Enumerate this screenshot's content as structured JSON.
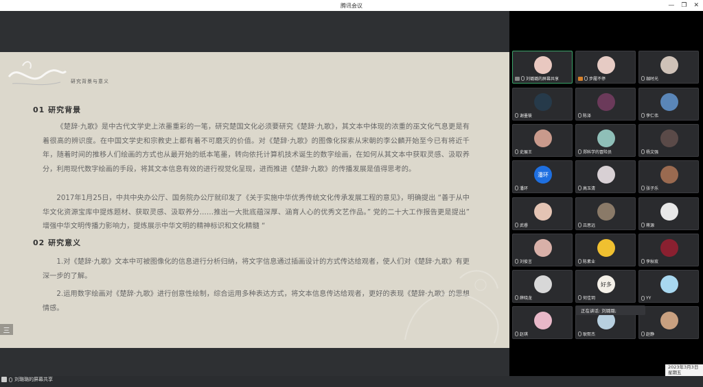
{
  "window": {
    "title": "腾讯会议",
    "minimize": "—",
    "restore": "❐",
    "close": "✕"
  },
  "slide": {
    "header": "研究背景与意义",
    "section1_title": "01  研究背景",
    "para1": "《楚辞·九歌》是中古代文学史上浓墨重彩的一笔，研究楚国文化必须要研究《楚辞·九歌》，其文本中体现的浓重的巫文化气息更是有着很高的辨识度。在中国文学史和宗教史上都有着不可磨灭的价值。对《楚辞·九歌》的图像化探索从宋朝的李公麟开始至今已有将近千年，随着时间的推移人们绘画的方式也从最开始的纸本笔墨，转向依托计算机技术诞生的数字绘画，在如何从其文本中获取灵感、汲取养分，利用现代数字绘画的手段，将其文本信息有效的进行视觉化呈现，进而推进《楚辞·九歌》的传播发展是值得思考的。",
    "para2": "2017年1月25日，中共中央办公厅、国务院办公厅就印发了《关于实施中华优秀传统文化传承发展工程的意见》，明确提出 “善于从中华文化资源宝库中提炼题材、获取灵感、汲取养分……推出一大批底蕴深厚、涵育人心的优秀文艺作品。” 党的二十大工作报告更是提出” 增强中华文明传播力影响力，提炼展示中华文明的精神标识和文化精髓 “",
    "section2_title": "02  研究意义",
    "para3": "1.对《楚辞·九歌》文本中可被图像化的信息进行分析归纳，将文字信息通过插画设计的方式传达给观者，使人们对《楚辞·九歌》有更深一步的了解。",
    "para4": "2.运用数字绘画对《楚辞·九歌》进行创意性绘制，综合运用多种表达方式，将文本信息传达给观者，更好的表现《楚辞·九歌》的思想情感。",
    "menu_icon": "三"
  },
  "bottom": {
    "sharing_label": "刘璐璐的屏幕共享"
  },
  "participants": [
    {
      "name": "刘璐璐的屏幕共享",
      "avatar_color": "#e9c8c0",
      "initial": "",
      "badge": "screen",
      "active": true
    },
    {
      "name": "步履不停",
      "avatar_color": "#e6cbc4",
      "initial": "",
      "badge": "host"
    },
    {
      "name": "珈时光",
      "avatar_color": "#cfc2b8",
      "initial": ""
    },
    {
      "name": "谢墨筱",
      "avatar_color": "#263a4a",
      "initial": ""
    },
    {
      "name": "陈泽",
      "avatar_color": "#6b3a5a",
      "initial": ""
    },
    {
      "name": "李仁伟",
      "avatar_color": "#5a86b8",
      "initial": ""
    },
    {
      "name": "史展王",
      "avatar_color": "#c99a8c",
      "initial": ""
    },
    {
      "name": "郑科学的冒险员",
      "avatar_color": "#8fbfb8",
      "initial": ""
    },
    {
      "name": "杨文强",
      "avatar_color": "#5a4a48",
      "initial": ""
    },
    {
      "name": "潘环",
      "avatar_color": "#1e6fe0",
      "initial": "潘环"
    },
    {
      "name": "高玉清",
      "avatar_color": "#d8d0d4",
      "initial": ""
    },
    {
      "name": "张子乐",
      "avatar_color": "#9a6a50",
      "initial": ""
    },
    {
      "name": "武睿",
      "avatar_color": "#e4c4b4",
      "initial": ""
    },
    {
      "name": "吕思远",
      "avatar_color": "#8a7a68",
      "initial": ""
    },
    {
      "name": "蒋源",
      "avatar_color": "#e8e8e8",
      "initial": ""
    },
    {
      "name": "刘俊言",
      "avatar_color": "#d8b0a8",
      "initial": ""
    },
    {
      "name": "陈素业",
      "avatar_color": "#f0c030",
      "initial": ""
    },
    {
      "name": "李秋玫",
      "avatar_color": "#8a2030",
      "initial": ""
    },
    {
      "name": "薛晓龙",
      "avatar_color": "#d8d8d8",
      "initial": ""
    },
    {
      "name": "何佳玥",
      "avatar_color": "#f4f0e8",
      "initial": "好多"
    },
    {
      "name": "YY",
      "avatar_color": "#a8d8f0",
      "initial": ""
    },
    {
      "name": "赵琪",
      "avatar_color": "#e8b8c8",
      "initial": ""
    },
    {
      "name": "耿熙杰",
      "avatar_color": "#b8d0e0",
      "initial": ""
    },
    {
      "name": "赵静",
      "avatar_color": "#c8a080",
      "initial": ""
    }
  ],
  "speaking": {
    "label": "正在讲话: 刘璐璐;"
  },
  "clock": {
    "date": "2023年3月3日",
    "weekday": "星期五"
  }
}
